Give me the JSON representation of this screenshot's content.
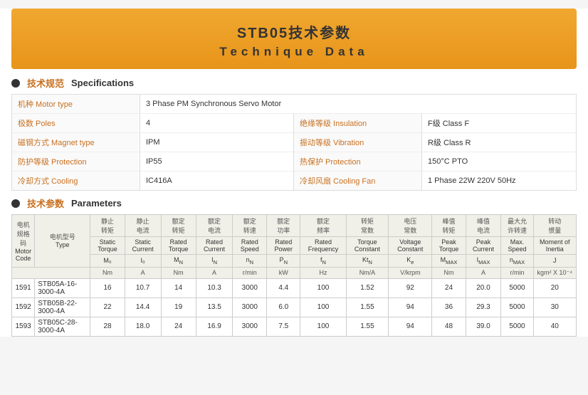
{
  "header": {
    "title_cn": "STB05技术参数",
    "title_en": "Technique Data"
  },
  "specs_section": {
    "bullet": "●",
    "title_cn": "技术规范",
    "title_en": "Specifications"
  },
  "specs": {
    "left": [
      {
        "label_cn": "机种 Motor type",
        "value": "3 Phase PM Synchronous Servo Motor"
      },
      {
        "label_cn": "极数 Poles",
        "value": "4"
      },
      {
        "label_cn": "磁钢方式 Magnet type",
        "value": "IPM"
      },
      {
        "label_cn": "防护等级 Protection",
        "value": "IP55"
      },
      {
        "label_cn": "冷却方式 Cooling",
        "value": "IC416A"
      }
    ],
    "right": [
      {
        "label_cn": "绝缘等级 Insulation",
        "value": "F级  Class F"
      },
      {
        "label_cn": "振动等级 Vibration",
        "value": "R级  Class R"
      },
      {
        "label_cn": "热保护 Protection",
        "value": "150°C PTO"
      },
      {
        "label_cn": "冷却风扇 Cooling Fan",
        "value": "1 Phase  22W  220V  50Hz"
      }
    ]
  },
  "params_section": {
    "bullet": "●",
    "title_cn": "技术参数",
    "title_en": "Parameters"
  },
  "table": {
    "headers": [
      {
        "cn": "电机规格码",
        "en": "Motor Code"
      },
      {
        "cn": "电机型号",
        "en": "Type"
      },
      {
        "cn": "静止转矩",
        "en": "Static Torque",
        "sym": "M₀",
        "unit": "Nm"
      },
      {
        "cn": "静止电流",
        "en": "Static Current",
        "sym": "I₀",
        "unit": "A"
      },
      {
        "cn": "额定转矩",
        "en": "Rated Torque",
        "sym": "MN",
        "unit": "Nm"
      },
      {
        "cn": "额定电流",
        "en": "Rated Current",
        "sym": "IN",
        "unit": "A"
      },
      {
        "cn": "额定转速",
        "en": "Rated Speed",
        "sym": "nN",
        "unit": "r/min"
      },
      {
        "cn": "额定功率",
        "en": "Rated Power",
        "sym": "PN",
        "unit": "kW"
      },
      {
        "cn": "额定频率",
        "en": "Rated Frequency",
        "sym": "fN",
        "unit": "Hz"
      },
      {
        "cn": "转矩常数",
        "en": "Torque Constant",
        "sym": "KtN",
        "unit": "Nm/A"
      },
      {
        "cn": "电压常数",
        "en": "Voltage Constant",
        "sym": "Ke",
        "unit": "V/krpm"
      },
      {
        "cn": "峰值转矩",
        "en": "Peak Torque",
        "sym": "MMAX",
        "unit": "Nm"
      },
      {
        "cn": "峰值电流",
        "en": "Peak Current",
        "sym": "IMAX",
        "unit": "A"
      },
      {
        "cn": "最大允许转速",
        "en": "Max. Speed",
        "sym": "nMAX",
        "unit": "r/min"
      },
      {
        "cn": "转动惯量",
        "en": "Moment of Inertia",
        "sym": "J",
        "unit": "kgm² X 10⁻⁴"
      }
    ],
    "rows": [
      {
        "code": "1591",
        "type": "STB05A-16-3000-4A",
        "values": [
          "16",
          "10.7",
          "14",
          "10.3",
          "3000",
          "4.4",
          "100",
          "1.52",
          "92",
          "24",
          "20.0",
          "5000",
          "20"
        ]
      },
      {
        "code": "1592",
        "type": "STB05B-22-3000-4A",
        "values": [
          "22",
          "14.4",
          "19",
          "13.5",
          "3000",
          "6.0",
          "100",
          "1.55",
          "94",
          "36",
          "29.3",
          "5000",
          "30"
        ]
      },
      {
        "code": "1593",
        "type": "STB05C-28-3000-4A",
        "values": [
          "28",
          "18.0",
          "24",
          "16.9",
          "3000",
          "7.5",
          "100",
          "1.55",
          "94",
          "48",
          "39.0",
          "5000",
          "40"
        ]
      }
    ]
  }
}
